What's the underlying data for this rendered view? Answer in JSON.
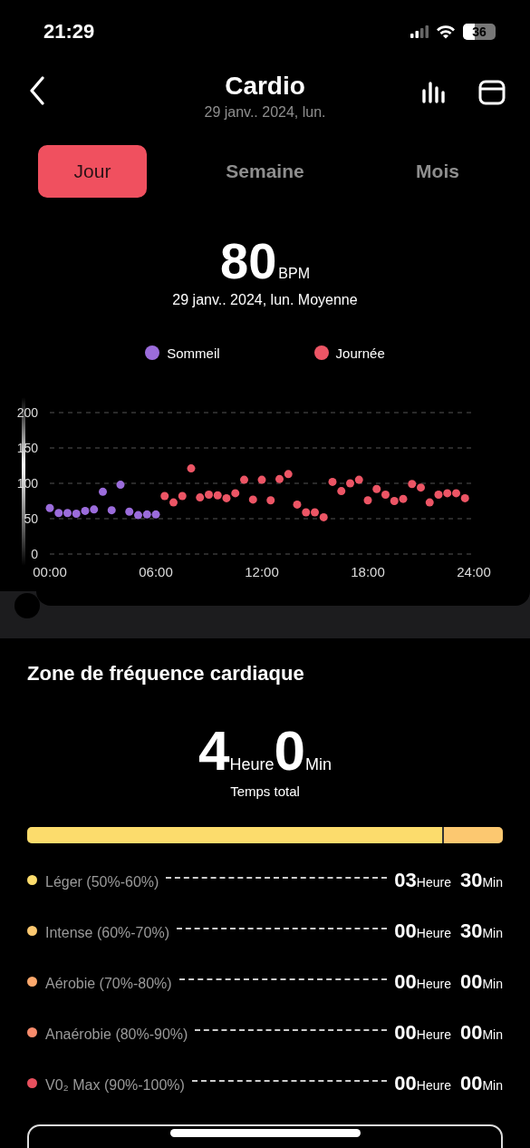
{
  "status_bar": {
    "time": "21:29",
    "battery": "36"
  },
  "header": {
    "title": "Cardio",
    "subtitle": "29 janv.. 2024, lun."
  },
  "tabs": [
    {
      "label": "Jour",
      "selected": true
    },
    {
      "label": "Semaine",
      "selected": false
    },
    {
      "label": "Mois",
      "selected": false
    }
  ],
  "summary": {
    "value": "80",
    "unit": "BPM",
    "caption": "29 janv.. 2024, lun. Moyenne"
  },
  "chart_data": {
    "type": "scatter",
    "grid": true,
    "x": [
      0,
      0.5,
      1,
      1.5,
      2,
      2.5,
      3,
      3.5,
      4,
      4.5,
      5,
      5.5,
      6,
      6.5,
      7,
      7.5,
      8,
      8.5,
      9,
      9.5,
      10,
      10.5,
      11,
      11.5,
      12,
      12.5,
      13,
      13.5,
      14,
      14.5,
      15,
      15.5,
      16,
      16.5,
      17,
      17.5,
      18,
      18.5,
      19,
      19.5,
      20,
      20.5,
      21,
      21.5,
      22,
      22.5,
      23,
      23.5
    ],
    "xlim": [
      0,
      24
    ],
    "ylim": [
      0,
      200
    ],
    "xticks": [
      {
        "value": 0,
        "label": "00:00"
      },
      {
        "value": 6,
        "label": "06:00"
      },
      {
        "value": 12,
        "label": "12:00"
      },
      {
        "value": 18,
        "label": "18:00"
      },
      {
        "value": 24,
        "label": "24:00"
      }
    ],
    "yticks": [
      0,
      50,
      100,
      150,
      200
    ],
    "series": [
      {
        "name": "Sommeil",
        "color": "#9b6cdb",
        "values": [
          65,
          58,
          58,
          57,
          61,
          63,
          88,
          62,
          98,
          60,
          55,
          56,
          56,
          null,
          null,
          null,
          null,
          null,
          null,
          null,
          null,
          null,
          null,
          null,
          null,
          null,
          null,
          null,
          null,
          null,
          null,
          null,
          null,
          null,
          null,
          null,
          null,
          null,
          null,
          null,
          null,
          null,
          null,
          null,
          null,
          null,
          null,
          null
        ]
      },
      {
        "name": "Journée",
        "color": "#ec5565",
        "values": [
          null,
          null,
          null,
          null,
          null,
          null,
          null,
          null,
          null,
          null,
          null,
          null,
          null,
          82,
          73,
          82,
          121,
          80,
          84,
          83,
          79,
          86,
          105,
          77,
          105,
          76,
          106,
          113,
          70,
          59,
          59,
          52,
          102,
          89,
          100,
          105,
          76,
          92,
          84,
          75,
          78,
          99,
          94,
          73,
          84,
          86,
          86,
          79
        ]
      }
    ]
  },
  "zones": {
    "title": "Zone de fréquence cardiaque",
    "total_hours": "4",
    "hours_unit": "Heure",
    "total_minutes": "0",
    "minutes_unit": "Min",
    "total_label": "Temps total",
    "items": [
      {
        "label": "Léger (50%-60%)",
        "color": "#fcdc6c",
        "level": 0.875,
        "hours": "03",
        "hours_unit": "Heure",
        "minutes": "30",
        "minutes_unit": "Min"
      },
      {
        "label": "Intense (60%-70%)",
        "color": "#fcc870",
        "level": 0.125,
        "hours": "00",
        "hours_unit": "Heure",
        "minutes": "30",
        "minutes_unit": "Min"
      },
      {
        "label": "Aérobie (70%-80%)",
        "color": "#fca86c",
        "hours": "00",
        "hours_unit": "Heure",
        "minutes": "00",
        "minutes_unit": "Min"
      },
      {
        "label": "Anaérobie (80%-90%)",
        "color": "#f88c6c",
        "hours": "00",
        "hours_unit": "Heure",
        "minutes": "00",
        "minutes_unit": "Min"
      },
      {
        "label": "V0₂ Max (90%-100%)",
        "color": "#e8505e",
        "hours": "00",
        "hours_unit": "Heure",
        "minutes": "00",
        "minutes_unit": "Min"
      }
    ]
  }
}
